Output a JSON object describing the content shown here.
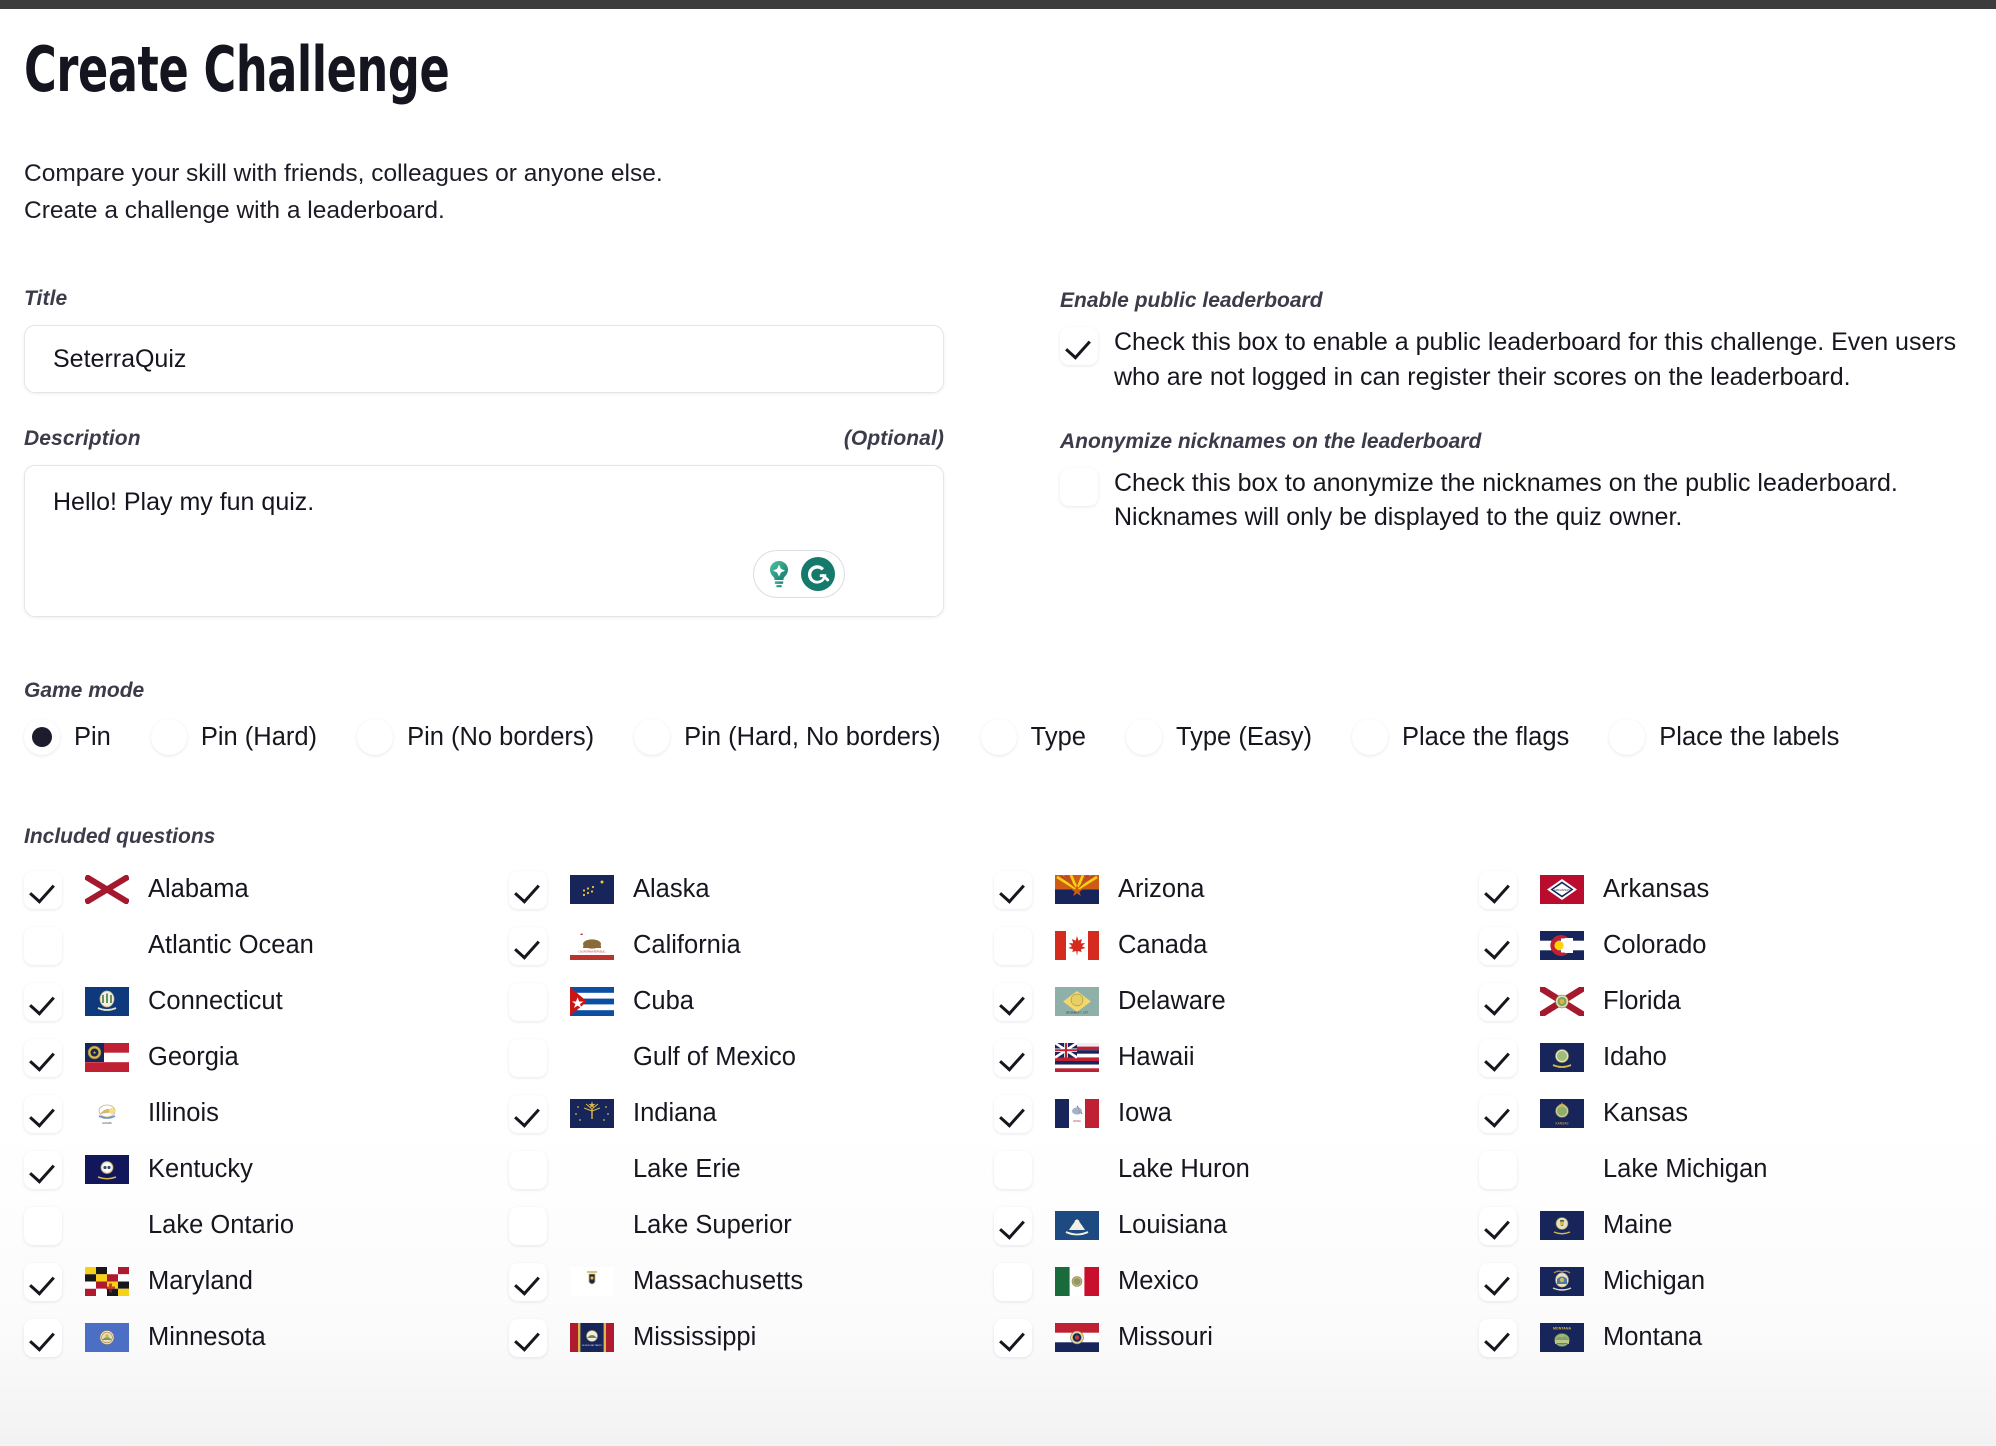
{
  "header": {
    "title": "Create Challenge",
    "intro_line1": "Compare your skill with friends, colleagues or anyone else.",
    "intro_line2": "Create a challenge with a leaderboard."
  },
  "form": {
    "title_label": "Title",
    "title_value": "SeterraQuiz",
    "description_label": "Description",
    "description_optional": "(Optional)",
    "description_value": "Hello! Play my fun quiz.",
    "grammarly_bulb_icon": "lightbulb-sparkle-icon",
    "grammarly_logo_icon": "grammarly-g-icon"
  },
  "leaderboard": {
    "public_label": "Enable public leaderboard",
    "public_text": "Check this box to enable a public leaderboard for this challenge. Even users who are not logged in can register their scores on the leaderboard.",
    "public_checked": true,
    "anonymize_label": "Anonymize nicknames on the leaderboard",
    "anonymize_text": "Check this box to anonymize the nicknames on the public leaderboard. Nicknames will only be displayed to the quiz owner.",
    "anonymize_checked": false
  },
  "game_mode": {
    "label": "Game mode",
    "options": [
      {
        "label": "Pin",
        "selected": true
      },
      {
        "label": "Pin (Hard)",
        "selected": false
      },
      {
        "label": "Pin (No borders)",
        "selected": false
      },
      {
        "label": "Pin (Hard, No borders)",
        "selected": false
      },
      {
        "label": "Type",
        "selected": false
      },
      {
        "label": "Type (Easy)",
        "selected": false
      },
      {
        "label": "Place the flags",
        "selected": false
      },
      {
        "label": "Place the labels",
        "selected": false
      }
    ]
  },
  "included_questions": {
    "label": "Included questions",
    "columns": [
      [
        {
          "name": "Alabama",
          "checked": true,
          "flag": "alabama"
        },
        {
          "name": "Atlantic Ocean",
          "checked": false,
          "flag": null
        },
        {
          "name": "Connecticut",
          "checked": true,
          "flag": "connecticut"
        },
        {
          "name": "Georgia",
          "checked": true,
          "flag": "georgia"
        },
        {
          "name": "Illinois",
          "checked": true,
          "flag": "illinois"
        },
        {
          "name": "Kentucky",
          "checked": true,
          "flag": "kentucky"
        },
        {
          "name": "Lake Ontario",
          "checked": false,
          "flag": null
        },
        {
          "name": "Maryland",
          "checked": true,
          "flag": "maryland"
        },
        {
          "name": "Minnesota",
          "checked": true,
          "flag": "minnesota"
        }
      ],
      [
        {
          "name": "Alaska",
          "checked": true,
          "flag": "alaska"
        },
        {
          "name": "California",
          "checked": true,
          "flag": "california"
        },
        {
          "name": "Cuba",
          "checked": false,
          "flag": "cuba"
        },
        {
          "name": "Gulf of Mexico",
          "checked": false,
          "flag": null
        },
        {
          "name": "Indiana",
          "checked": true,
          "flag": "indiana"
        },
        {
          "name": "Lake Erie",
          "checked": false,
          "flag": null
        },
        {
          "name": "Lake Superior",
          "checked": false,
          "flag": null
        },
        {
          "name": "Massachusetts",
          "checked": true,
          "flag": "massachusetts"
        },
        {
          "name": "Mississippi",
          "checked": true,
          "flag": "mississippi"
        }
      ],
      [
        {
          "name": "Arizona",
          "checked": true,
          "flag": "arizona"
        },
        {
          "name": "Canada",
          "checked": false,
          "flag": "canada"
        },
        {
          "name": "Delaware",
          "checked": true,
          "flag": "delaware"
        },
        {
          "name": "Hawaii",
          "checked": true,
          "flag": "hawaii"
        },
        {
          "name": "Iowa",
          "checked": true,
          "flag": "iowa"
        },
        {
          "name": "Lake Huron",
          "checked": false,
          "flag": null
        },
        {
          "name": "Louisiana",
          "checked": true,
          "flag": "louisiana"
        },
        {
          "name": "Mexico",
          "checked": false,
          "flag": "mexico"
        },
        {
          "name": "Missouri",
          "checked": true,
          "flag": "missouri"
        }
      ],
      [
        {
          "name": "Arkansas",
          "checked": true,
          "flag": "arkansas"
        },
        {
          "name": "Colorado",
          "checked": true,
          "flag": "colorado"
        },
        {
          "name": "Florida",
          "checked": true,
          "flag": "florida"
        },
        {
          "name": "Idaho",
          "checked": true,
          "flag": "idaho"
        },
        {
          "name": "Kansas",
          "checked": true,
          "flag": "kansas"
        },
        {
          "name": "Lake Michigan",
          "checked": false,
          "flag": null
        },
        {
          "name": "Maine",
          "checked": true,
          "flag": "maine"
        },
        {
          "name": "Michigan",
          "checked": true,
          "flag": "michigan"
        },
        {
          "name": "Montana",
          "checked": true,
          "flag": "montana"
        }
      ]
    ]
  },
  "colors": {
    "text": "#16161f",
    "label": "#3b3b4a",
    "accent": "#1c1c2c",
    "grammarly_green": "#15796b",
    "top_bar": "#3c3c3c"
  }
}
